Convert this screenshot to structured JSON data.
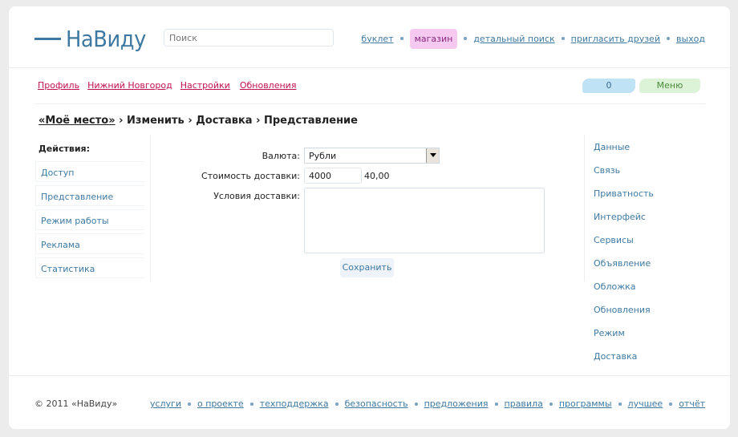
{
  "brand": {
    "name": "НаВиду"
  },
  "search": {
    "placeholder": "Поиск"
  },
  "topnav": [
    "буклет",
    "магазин",
    "детальный поиск",
    "пригласить друзей",
    "выход"
  ],
  "subnav": [
    "Профиль",
    "Нижний Новгород",
    "Настройки",
    "Обновления"
  ],
  "badges": {
    "count": "0",
    "menu": "Меню"
  },
  "breadcrumb": {
    "home": "«Моё место»",
    "sep": "›",
    "items": [
      "Изменить",
      "Доставка",
      "Представление"
    ]
  },
  "actions": {
    "title": "Действия:",
    "items": [
      "Доступ",
      "Представление",
      "Режим работы",
      "Реклама",
      "Статистика"
    ]
  },
  "form": {
    "currency_label": "Валюта:",
    "currency_value": "Рубли",
    "cost_label": "Стоимость доставки:",
    "cost_value": "4000",
    "cost_display": "40,00",
    "terms_label": "Условия доставки:",
    "save_label": "Сохранить"
  },
  "rightmenu": [
    "Данные",
    "Связь",
    "Приватность",
    "Интерфейс",
    "Сервисы",
    "Объявление",
    "Обложка",
    "Обновления",
    "Режим",
    "Доставка"
  ],
  "footer": {
    "copyright": "© 2011 «НаВиду»",
    "links": [
      "услуги",
      "о проекте",
      "техподдержка",
      "безопасность",
      "предложения",
      "правила",
      "программы",
      "лучшее",
      "отчёт"
    ]
  },
  "colors": {
    "link": "#3f79a1",
    "accent_pink": "#c0114e",
    "shop_bg": "#f5c9f0"
  }
}
